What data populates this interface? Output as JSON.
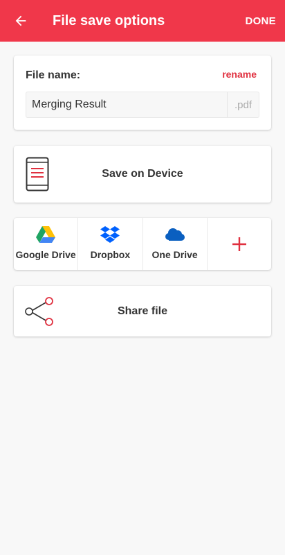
{
  "appbar": {
    "title": "File save options",
    "done_label": "DONE",
    "back_icon": "arrow-left-icon",
    "color": "#f0374a"
  },
  "filename": {
    "label": "File name:",
    "rename_label": "rename",
    "value": "Merging Result",
    "extension": ".pdf"
  },
  "device": {
    "label": "Save on Device",
    "icon": "phone-document-icon"
  },
  "clouds": [
    {
      "label": "Google Drive",
      "icon": "google-drive-icon"
    },
    {
      "label": "Dropbox",
      "icon": "dropbox-icon"
    },
    {
      "label": "One Drive",
      "icon": "onedrive-icon"
    },
    {
      "label": "",
      "icon": "plus-icon"
    }
  ],
  "share": {
    "label": "Share file",
    "icon": "share-icon"
  }
}
